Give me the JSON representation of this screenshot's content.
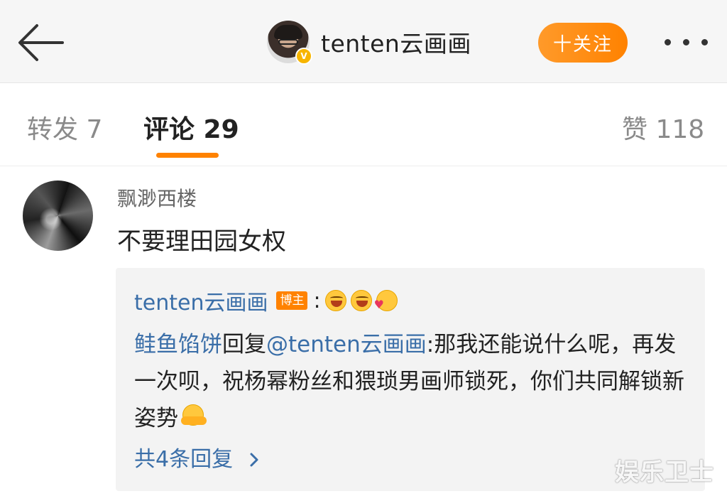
{
  "header": {
    "username": "tenten云画画",
    "follow_label": "十关注",
    "verified_badge": "V"
  },
  "tabs": [
    {
      "label": "转发 7"
    },
    {
      "label": "评论 29"
    },
    {
      "label": "赞 118"
    }
  ],
  "comment": {
    "username": "飘渺西楼",
    "text": "不要理田园女权",
    "reply": {
      "author": "tenten云画画",
      "author_badge": "博主",
      "colon": ":",
      "emojis": [
        "laughing-icon",
        "laughing-icon",
        "kiss-icon"
      ],
      "reply_user": "鲑鱼馅饼",
      "reply_word": "回复",
      "mention": "@tenten云画画",
      "reply_text": ":那我还能说什么呢，再发一次呗，祝杨幂粉丝和猥琐男画师锁死，你们共同解锁新姿势",
      "trailing_emoji": "hug-icon",
      "more_label": "共4条回复"
    }
  },
  "watermark": "娱乐卫士",
  "colors": {
    "accent": "#ff8200",
    "link": "#3a6ea8"
  }
}
